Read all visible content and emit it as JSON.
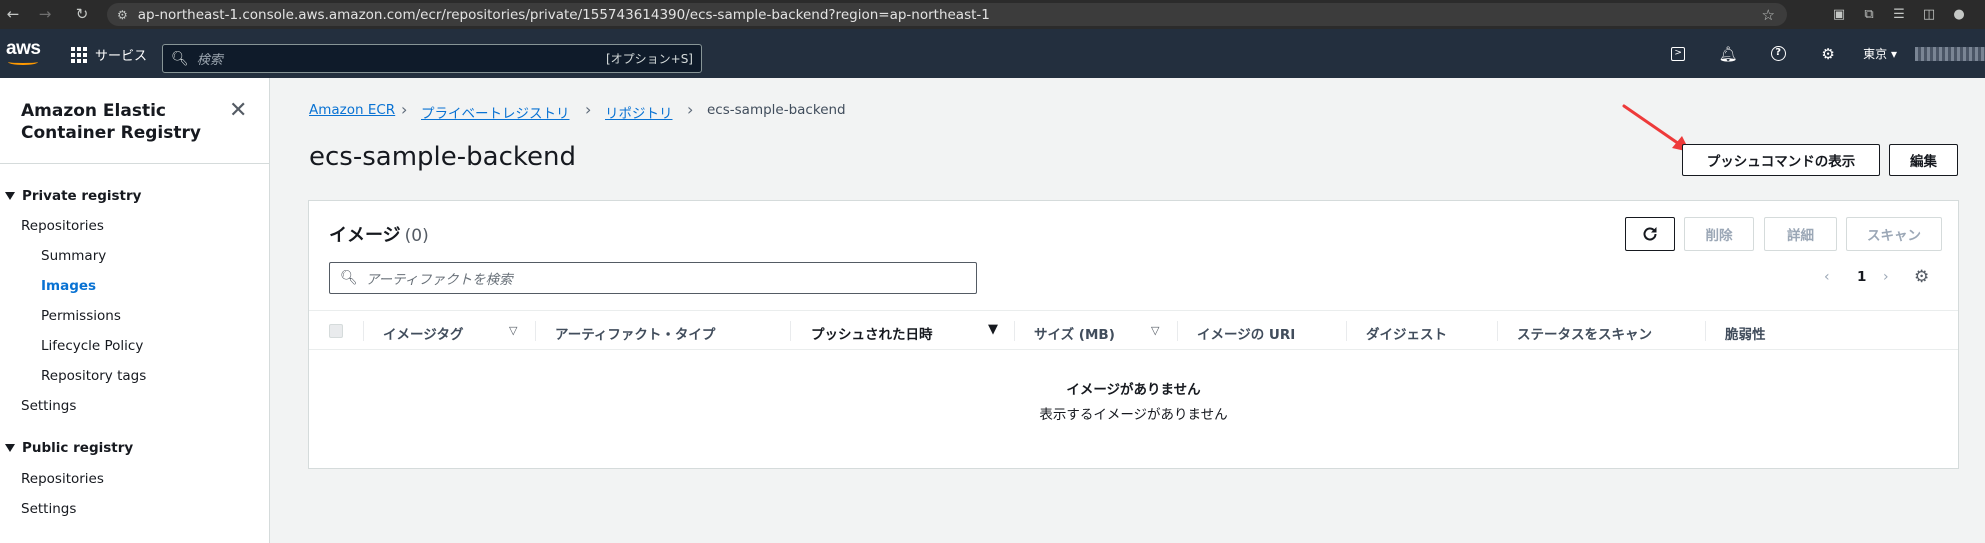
{
  "browser": {
    "url": "ap-northeast-1.console.aws.amazon.com/ecr/repositories/private/155743614390/ecs-sample-backend?region=ap-northeast-1"
  },
  "aws_nav": {
    "logo": "aws",
    "services_label": "サービス",
    "search_placeholder": "検索",
    "search_shortcut": "[オプション+S]",
    "region": "東京 ▾"
  },
  "sidebar": {
    "title": "Amazon Elastic Container Registry",
    "sections": [
      {
        "label": "Private registry",
        "items": [
          {
            "label": "Repositories",
            "level": 1
          },
          {
            "label": "Summary",
            "level": 2
          },
          {
            "label": "Images",
            "level": 2,
            "active": true
          },
          {
            "label": "Permissions",
            "level": 2
          },
          {
            "label": "Lifecycle Policy",
            "level": 2
          },
          {
            "label": "Repository tags",
            "level": 2
          },
          {
            "label": "Settings",
            "level": 1
          }
        ]
      },
      {
        "label": "Public registry",
        "items": [
          {
            "label": "Repositories",
            "level": 1
          },
          {
            "label": "Settings",
            "level": 1
          }
        ]
      }
    ]
  },
  "breadcrumb": {
    "items": [
      "Amazon ECR",
      "プライベートレジストリ",
      "リポジトリ"
    ],
    "current": "ecs-sample-backend"
  },
  "page": {
    "title": "ecs-sample-backend",
    "push_commands_button": "プッシュコマンドの表示",
    "edit_button": "編集"
  },
  "images_panel": {
    "title": "イメージ",
    "count": "(0)",
    "delete_button": "削除",
    "details_button": "詳細",
    "scan_button": "スキャン",
    "search_placeholder": "アーティファクトを検索",
    "page_number": "1",
    "columns": [
      "イメージタグ",
      "アーティファクト・タイプ",
      "プッシュされた日時",
      "サイズ (MB)",
      "イメージの URI",
      "ダイジェスト",
      "ステータスをスキャン",
      "脆弱性"
    ],
    "empty_title": "イメージがありません",
    "empty_description": "表示するイメージがありません"
  },
  "colors": {
    "aws_nav_bg": "#232f3e",
    "link_blue": "#0972d3",
    "arrow_red": "#ee3a3a"
  }
}
